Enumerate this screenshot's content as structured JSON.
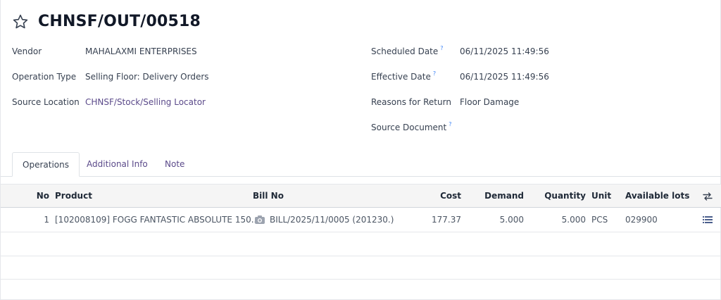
{
  "record": {
    "title": "CHNSF/OUT/00518"
  },
  "fields_left": {
    "vendor_label": "Vendor",
    "vendor_value": "MAHALAXMI ENTERPRISES",
    "operation_type_label": "Operation Type",
    "operation_type_value": "Selling Floor: Delivery Orders",
    "source_location_label": "Source Location",
    "source_location_value": "CHNSF/Stock/Selling Locator"
  },
  "fields_right": {
    "scheduled_date_label": "Scheduled Date",
    "scheduled_date_value": "06/11/2025 11:49:56",
    "effective_date_label": "Effective Date",
    "effective_date_value": "06/11/2025 11:49:56",
    "reasons_label": "Reasons for Return",
    "reasons_value": "Floor Damage",
    "source_document_label": "Source Document",
    "help_mark": "?"
  },
  "tabs": [
    {
      "label": "Operations",
      "active": true
    },
    {
      "label": "Additional Info",
      "active": false
    },
    {
      "label": "Note",
      "active": false
    }
  ],
  "table": {
    "headers": {
      "no": "No",
      "product": "Product",
      "bill_no": "Bill No",
      "cost": "Cost",
      "demand": "Demand",
      "quantity": "Quantity",
      "unit": "Unit",
      "available_lots": "Available lots"
    },
    "rows": [
      {
        "no": "1",
        "product": "[102008109] FOGG FANTASTIC ABSOLUTE 150...",
        "bill_no": "BILL/2025/11/0005 (201230.)",
        "cost": "177.37",
        "demand": "5.000",
        "quantity": "5.000",
        "unit": "PCS",
        "available_lots": "029900"
      }
    ]
  },
  "colors": {
    "link": "#5b4a8a",
    "help": "#3b82f6"
  },
  "icons": {
    "favorite": "star-outline-icon",
    "optional_columns": "column-toggle-icon",
    "row_detail": "list-detail-icon",
    "bill": "camera-icon"
  }
}
